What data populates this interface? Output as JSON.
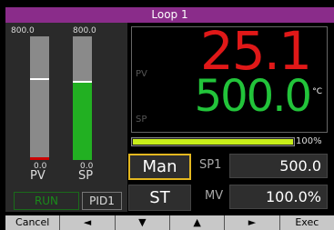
{
  "title": "Loop 1",
  "bars": {
    "pv": {
      "top_label": "800.0",
      "bottom_label": "0.0",
      "name": "PV",
      "level_percent": 0.4,
      "marker_percent": 65
    },
    "sp": {
      "top_label": "800.0",
      "bottom_label": "0.0",
      "name": "SP",
      "level_percent": 62.5,
      "marker_percent": 62.5
    }
  },
  "status": {
    "run": "RUN",
    "pid": "PID1"
  },
  "display": {
    "pv_tag": "PV",
    "sp_tag": "SP",
    "pv_value": "25.1",
    "sp_value": "500.0",
    "unit": "°C"
  },
  "mv_bar": {
    "percent_label": "100%",
    "fill_percent": 100
  },
  "mode_button": "Man",
  "st_button": "ST",
  "sp1": {
    "label": "SP1",
    "value": "500.0"
  },
  "mv": {
    "label": "MV",
    "value": "100.0%"
  },
  "fkeys": [
    "Cancel",
    "◄",
    "▼",
    "▲",
    "►",
    "Exec"
  ],
  "colors": {
    "title_bg": "#8a2c8a",
    "pv": "#e01818",
    "sp": "#22c43a",
    "mv_bar": "#c8ee1a",
    "mode_border": "#e4b820",
    "run": "#1a8a1a"
  }
}
